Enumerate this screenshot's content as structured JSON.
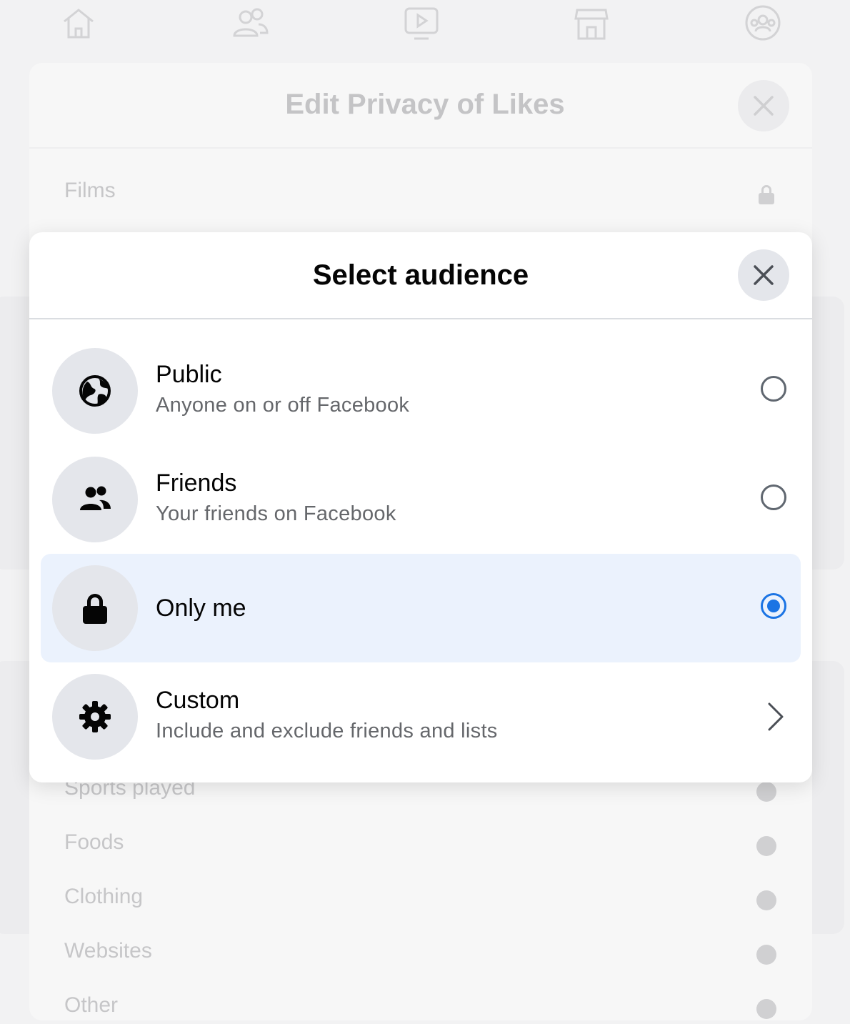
{
  "background": {
    "nav_icons": [
      "home-icon",
      "friends-icon",
      "watch-icon",
      "marketplace-icon",
      "groups-icon"
    ],
    "sheet_title": "Edit Privacy of Likes",
    "rows": [
      {
        "label": "Films",
        "icon": "lock-icon"
      },
      {
        "label": "Sports played",
        "icon": "globe-icon"
      },
      {
        "label": "Foods",
        "icon": "globe-icon"
      },
      {
        "label": "Clothing",
        "icon": "globe-icon"
      },
      {
        "label": "Websites",
        "icon": "globe-icon"
      },
      {
        "label": "Other",
        "icon": "globe-icon"
      }
    ]
  },
  "modal": {
    "title": "Select audience",
    "options": [
      {
        "label": "Public",
        "description": "Anyone on or off Facebook",
        "icon": "globe-icon",
        "selected": false
      },
      {
        "label": "Friends",
        "description": "Your friends on Facebook",
        "icon": "friends-icon",
        "selected": false
      },
      {
        "label": "Only me",
        "description": "",
        "icon": "lock-icon",
        "selected": true
      },
      {
        "label": "Custom",
        "description": "Include and exclude friends and lists",
        "icon": "gear-icon",
        "selected": false
      }
    ]
  },
  "colors": {
    "accent": "#1b74e4",
    "selected_row": "#ebf2fd",
    "icon_circle": "#e4e6eb",
    "secondary_text": "#65676b"
  }
}
